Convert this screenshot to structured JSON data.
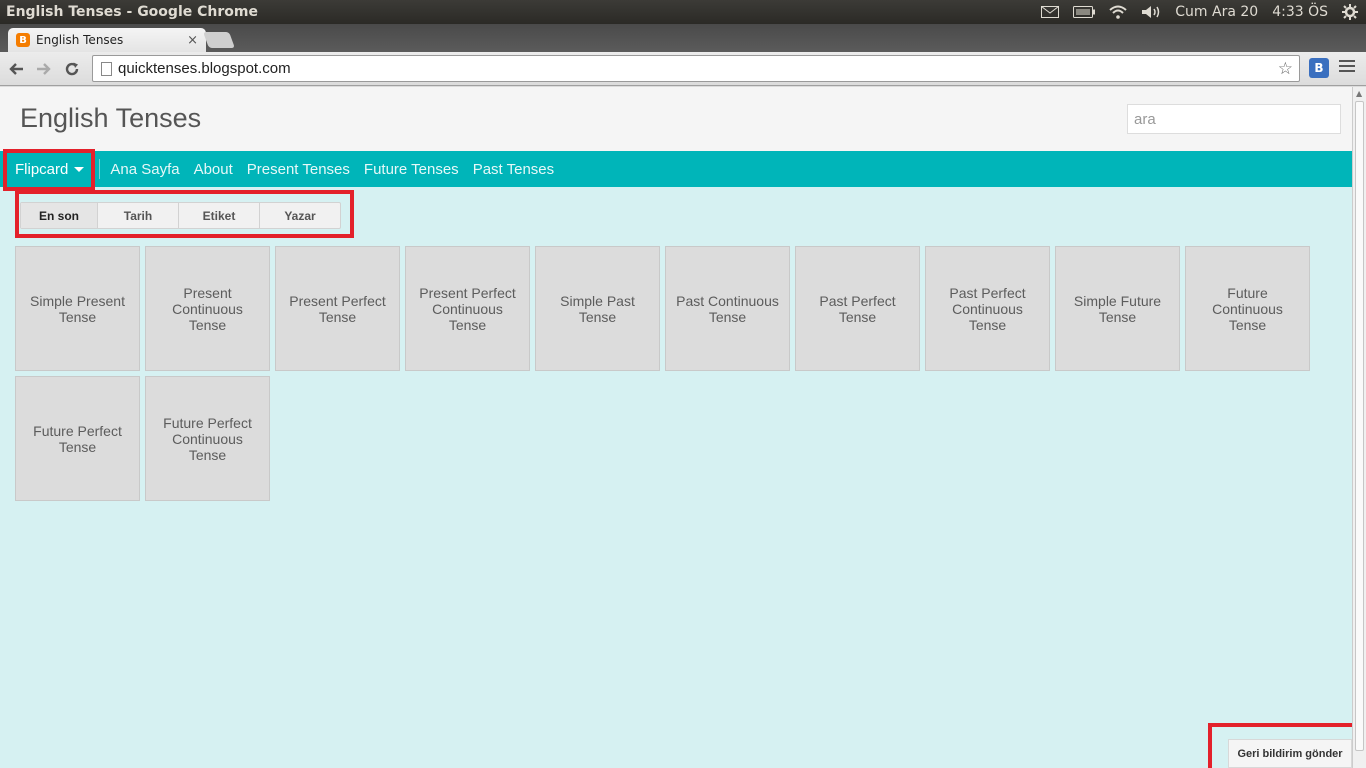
{
  "window": {
    "title": "English Tenses - Google Chrome",
    "clock_date": "Cum Ara 20",
    "clock_time": "4:33 ÖS"
  },
  "browser": {
    "tab_title": "English Tenses",
    "tab_close": "×",
    "url": "quicktenses.blogspot.com",
    "extension_label": "B"
  },
  "blog": {
    "title": "English Tenses",
    "search_placeholder": "ara"
  },
  "nav": {
    "view_label": "Flipcard",
    "links": [
      "Ana Sayfa",
      "About",
      "Present Tenses",
      "Future Tenses",
      "Past Tenses"
    ]
  },
  "sort_options": [
    "En son",
    "Tarih",
    "Etiket",
    "Yazar"
  ],
  "cards": [
    "Simple Present Tense",
    "Present Continuous Tense",
    "Present Perfect Tense",
    "Present Perfect Continuous Tense",
    "Simple Past Tense",
    "Past Continuous Tense",
    "Past Perfect Tense",
    "Past Perfect Continuous Tense",
    "Simple Future Tense",
    "Future Continuous Tense",
    "Future Perfect Tense",
    "Future Perfect Continuous Tense"
  ],
  "feedback_label": "Geri bildirim gönder",
  "colors": {
    "nav_bar": "#00b5b9",
    "page_bg": "#d6f1f2",
    "highlight": "#e3212b"
  }
}
